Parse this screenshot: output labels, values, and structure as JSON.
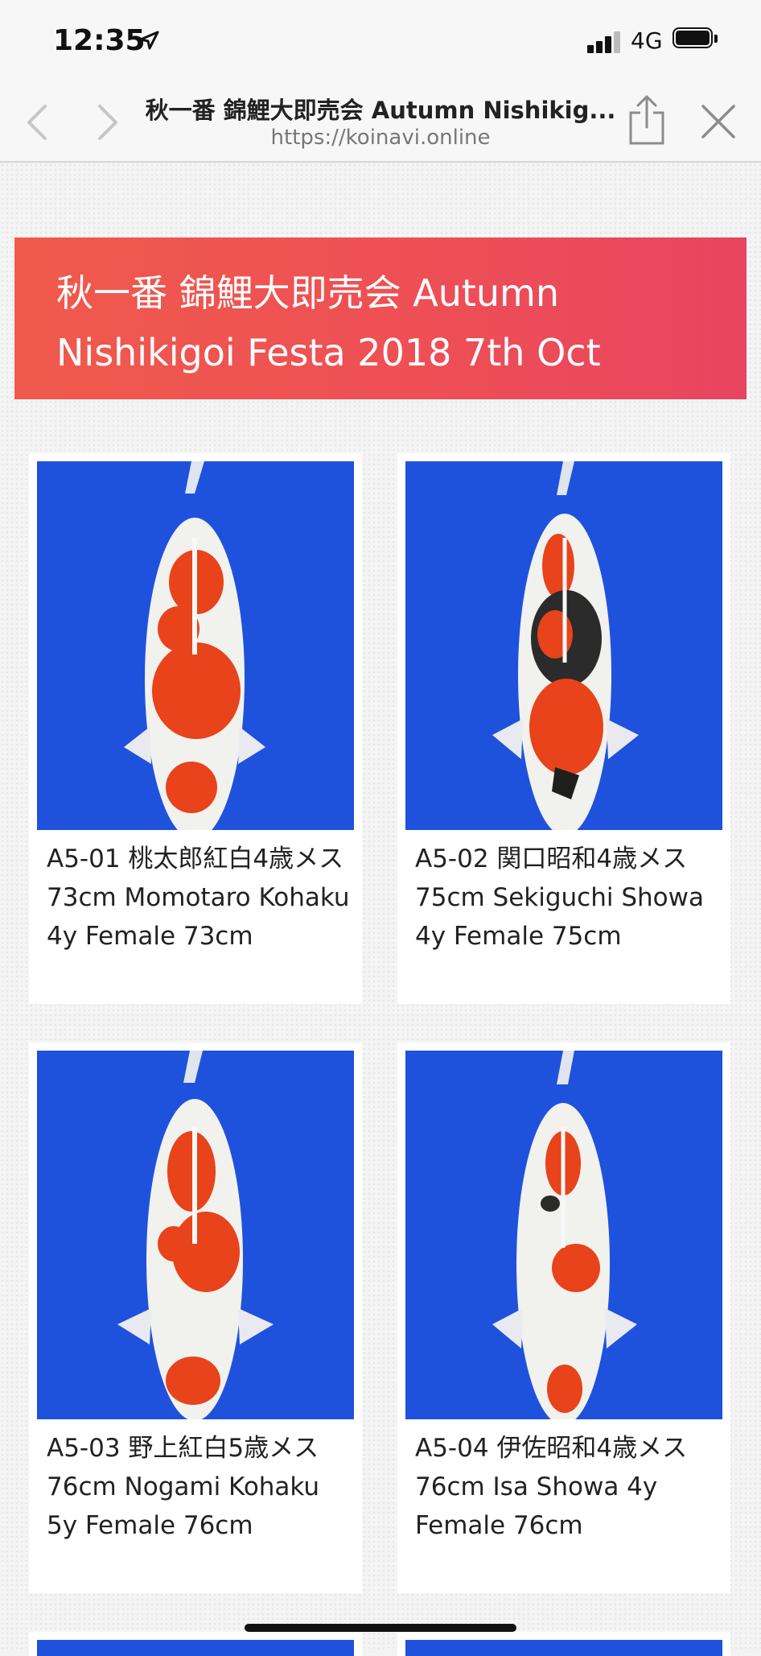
{
  "status_bar": {
    "time": "12:35",
    "network": "4G",
    "location_icon": "location-arrow-icon",
    "signal_icon": "cellular-signal-icon",
    "battery_icon": "battery-icon"
  },
  "browser": {
    "title": "秋一番 錦鯉大即売会 Autumn Nishikig...",
    "url": "https://koinavi.online",
    "icons": [
      "back-chevron-icon",
      "forward-chevron-icon",
      "share-icon",
      "close-icon"
    ]
  },
  "banner": {
    "line1": "秋一番 錦鯉大即売会 Autumn",
    "line2": "Nishikigoi Festa 2018 7th Oct",
    "color": "#ee4f55"
  },
  "listings": [
    {
      "caption": "A5-01 桃太郎紅白4歳メス73cm Momotaro Kohaku 4y Female 73cm"
    },
    {
      "caption": "A5-02 関口昭和4歳メス75cm Sekiguchi Showa 4y Female 75cm"
    },
    {
      "caption": "A5-03 野上紅白5歳メス76cm Nogami Kohaku 5y Female 76cm"
    },
    {
      "caption": "A5-04 伊佐昭和4歳メス76cm Isa Showa 4y Female 76cm"
    }
  ],
  "colors": {
    "photo_background": "#1c4fd6",
    "koi_red": "#e8431a",
    "koi_white": "#f4f4f0"
  }
}
